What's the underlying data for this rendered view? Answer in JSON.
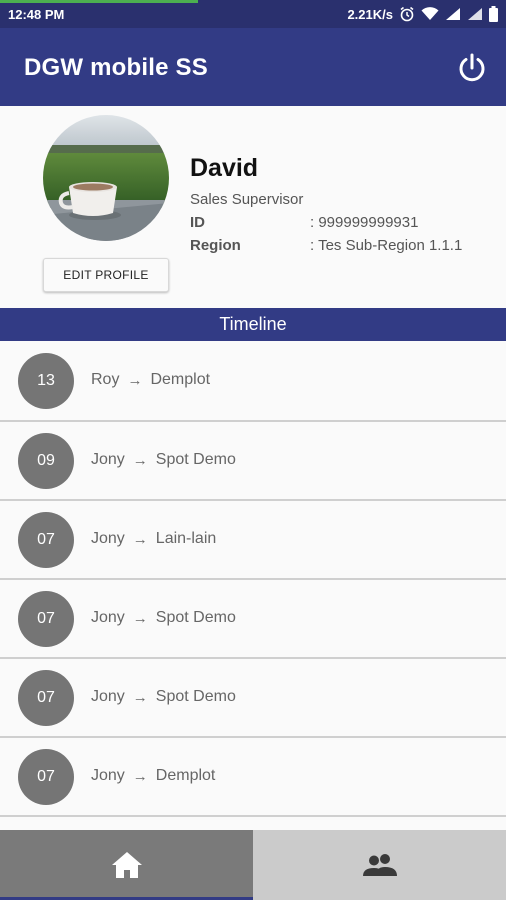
{
  "status_bar": {
    "time": "12:48 PM",
    "network_speed": "2.21K/s",
    "icons": [
      "alarm-icon",
      "wifi-icon",
      "signal-icon",
      "signal-icon",
      "battery-icon"
    ]
  },
  "app_bar": {
    "title": "DGW mobile SS",
    "power_icon": "power-icon"
  },
  "profile": {
    "name": "David",
    "role": "Sales Supervisor",
    "id_label": "ID",
    "id_value": ": 999999999931",
    "region_label": "Region",
    "region_value": ": Tes Sub-Region 1.1.1",
    "edit_button": "EDIT PROFILE"
  },
  "timeline": {
    "title": "Timeline",
    "items": [
      {
        "day": "13",
        "from": "Roy",
        "to": "Demplot"
      },
      {
        "day": "09",
        "from": "Jony",
        "to": "Spot Demo"
      },
      {
        "day": "07",
        "from": "Jony",
        "to": "Lain-lain"
      },
      {
        "day": "07",
        "from": "Jony",
        "to": "Spot Demo"
      },
      {
        "day": "07",
        "from": "Jony",
        "to": "Spot Demo"
      },
      {
        "day": "07",
        "from": "Jony",
        "to": "Demplot"
      }
    ]
  },
  "bottom_nav": {
    "items": [
      "home-icon",
      "people-icon"
    ],
    "active": "home-icon"
  },
  "colors": {
    "primary": "#323b85",
    "status_bar": "#2a306e",
    "circle": "#757575",
    "nav_active": "#7a7a7a",
    "nav_inactive": "#cbcbcb"
  }
}
